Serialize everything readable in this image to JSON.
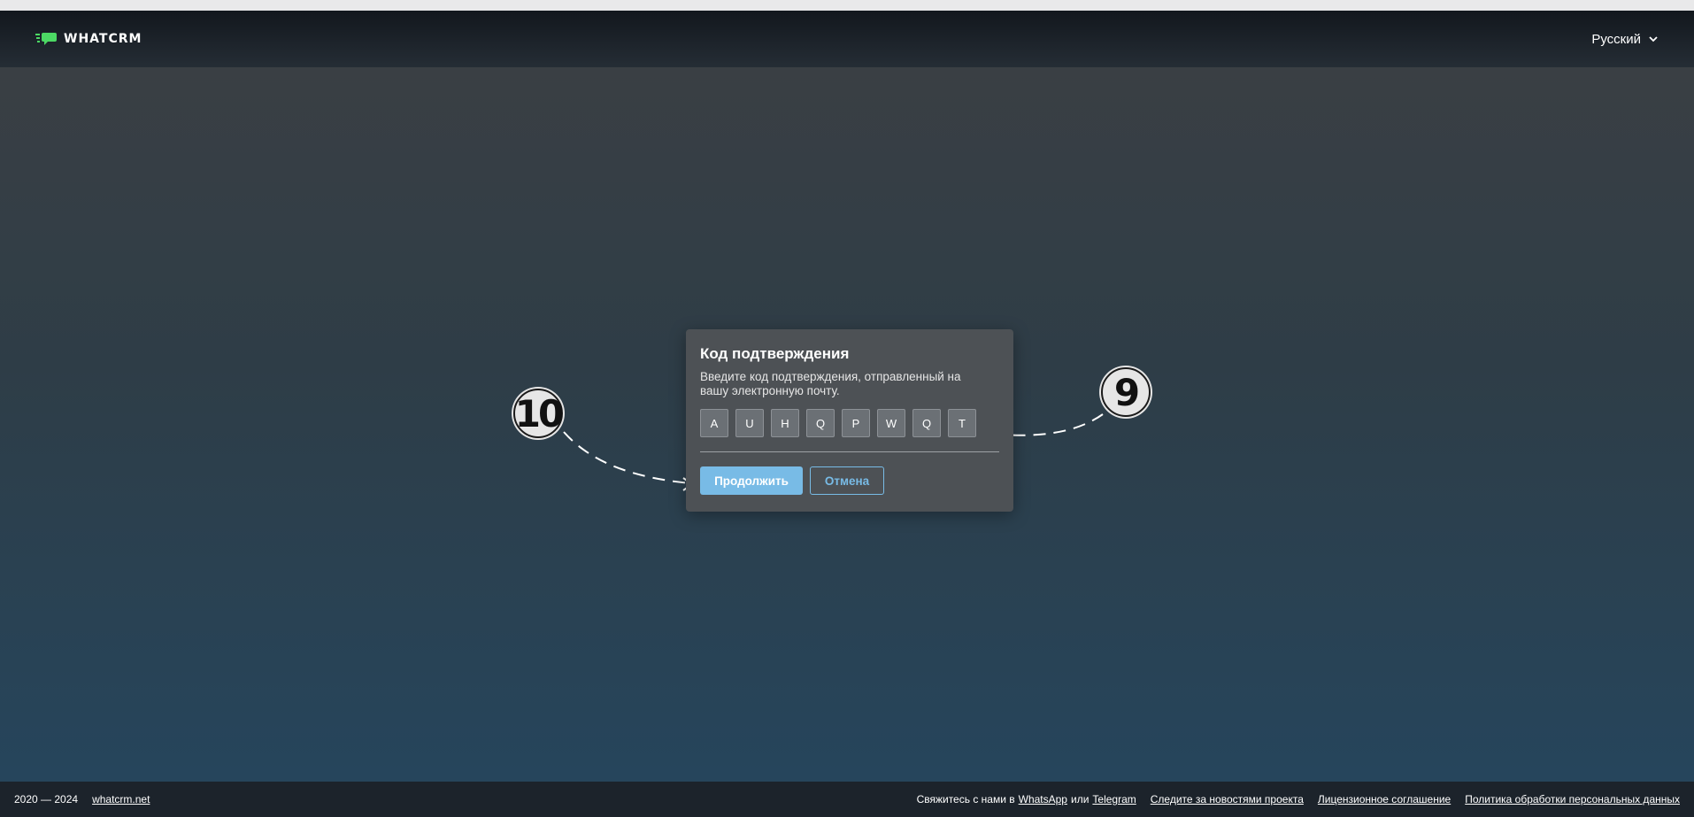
{
  "header": {
    "logo_text": "WHATCRM",
    "language": "Русский"
  },
  "modal": {
    "title": "Код подтверждения",
    "description": "Введите код подтверждения, отправленный на вашу электронную почту.",
    "code": [
      "A",
      "U",
      "H",
      "Q",
      "P",
      "W",
      "Q",
      "T"
    ],
    "continue_label": "Продолжить",
    "cancel_label": "Отмена"
  },
  "annotations": {
    "badge_left": "10",
    "badge_right": "9"
  },
  "footer": {
    "years": "2020 — 2024",
    "site_link": "whatcrm.net",
    "contact_prefix": "Свяжитесь с нами в",
    "whatsapp_link": "WhatsApp",
    "or_text": "или",
    "telegram_link": "Telegram",
    "news_link": "Следите за новостями проекта",
    "license_link": "Лицензионное соглашение",
    "privacy_link": "Политика обработки персональных данных"
  },
  "colors": {
    "accent": "#78bbe6",
    "logo_green": "#4cd964"
  },
  "icons": {
    "logo": "chat-bubble-lines-icon",
    "language_dropdown": "chevron-down-icon"
  }
}
